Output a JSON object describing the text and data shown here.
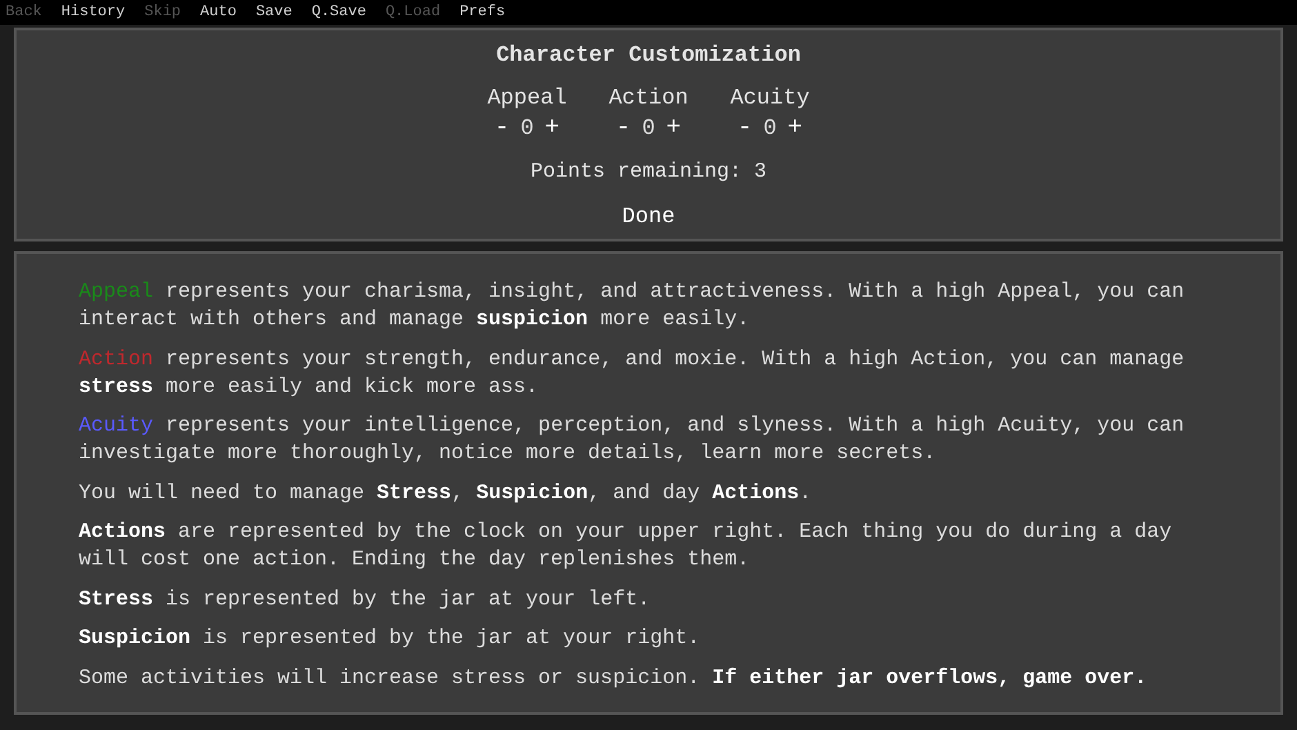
{
  "menu": [
    {
      "label": "Back",
      "disabled": true
    },
    {
      "label": "History",
      "disabled": false
    },
    {
      "label": "Skip",
      "disabled": true
    },
    {
      "label": "Auto",
      "disabled": false
    },
    {
      "label": "Save",
      "disabled": false
    },
    {
      "label": "Q.Save",
      "disabled": false
    },
    {
      "label": "Q.Load",
      "disabled": true
    },
    {
      "label": "Prefs",
      "disabled": false
    }
  ],
  "customization": {
    "title": "Character Customization",
    "stats": [
      {
        "name": "Appeal",
        "minus": "-",
        "value": "0",
        "plus": "+"
      },
      {
        "name": "Action",
        "minus": "-",
        "value": "0",
        "plus": "+"
      },
      {
        "name": "Acuity",
        "minus": "-",
        "value": "0",
        "plus": "+"
      }
    ],
    "points": "Points remaining: 3",
    "done": "Done"
  },
  "help": [
    {
      "lead": "Appeal",
      "color": "#1a8a1a",
      "text": " represents your charisma, insight, and attractiveness. With a high Appeal, you can interact with others and manage **suspicion** more easily."
    },
    {
      "lead": "Action",
      "color": "#c0282d",
      "text": " represents your strength, endurance, and moxie. With a high Action, you can manage **stress** more easily and kick more ass."
    },
    {
      "lead": "Acuity",
      "color": "#5a5aff",
      "text": " represents your intelligence, perception, and slyness. With a high Acuity, you can investigate more thoroughly, notice more details, learn more secrets."
    },
    {
      "text": "You will need to manage **Stress**, **Suspicion**, and day **Actions**."
    },
    {
      "text": "**Actions** are represented by the clock on your upper right. Each thing you do during a day will cost one action. Ending the day replenishes them."
    },
    {
      "text": "**Stress** is represented by the jar at your left."
    },
    {
      "text": "**Suspicion** is represented by the jar at your right."
    },
    {
      "text": "Some activities will increase stress or suspicion. **If either jar overflows, game over.**"
    }
  ]
}
